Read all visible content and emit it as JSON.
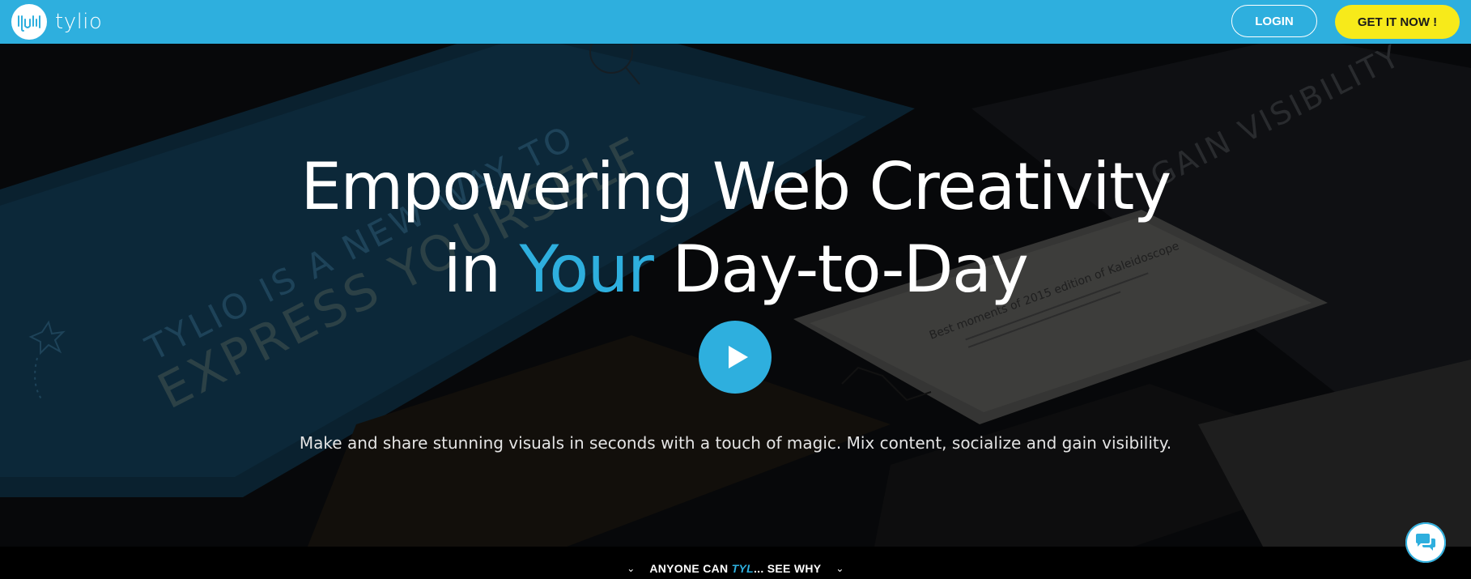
{
  "header": {
    "brand": "tylio",
    "login_label": "LOGIN",
    "cta_label": "GET IT NOW !",
    "bg_color": "#2eafde",
    "cta_color": "#f7ea1a"
  },
  "hero": {
    "headline_line1": "Empowering Web Creativity",
    "headline_in": "in",
    "headline_accent": "Your",
    "headline_rest": "Day-to-Day",
    "play_icon": "play-icon",
    "subline": "Make and share stunning visuals in seconds with a touch of magic. Mix content, socialize and gain visibility.",
    "bg_texts": {
      "card1_line1": "TYLIO IS A NEW WAY TO",
      "card1_line2": "EXPRESS YOURSELF",
      "card2": "GAIN VISIBILITY",
      "card3": "Best moments of 2015 edition of Kaleidoscope"
    }
  },
  "footer_strip": {
    "prefix": "ANYONE CAN",
    "accent": "TYL",
    "suffix": "... SEE WHY"
  },
  "chat": {
    "icon": "chat-bubbles-icon"
  }
}
